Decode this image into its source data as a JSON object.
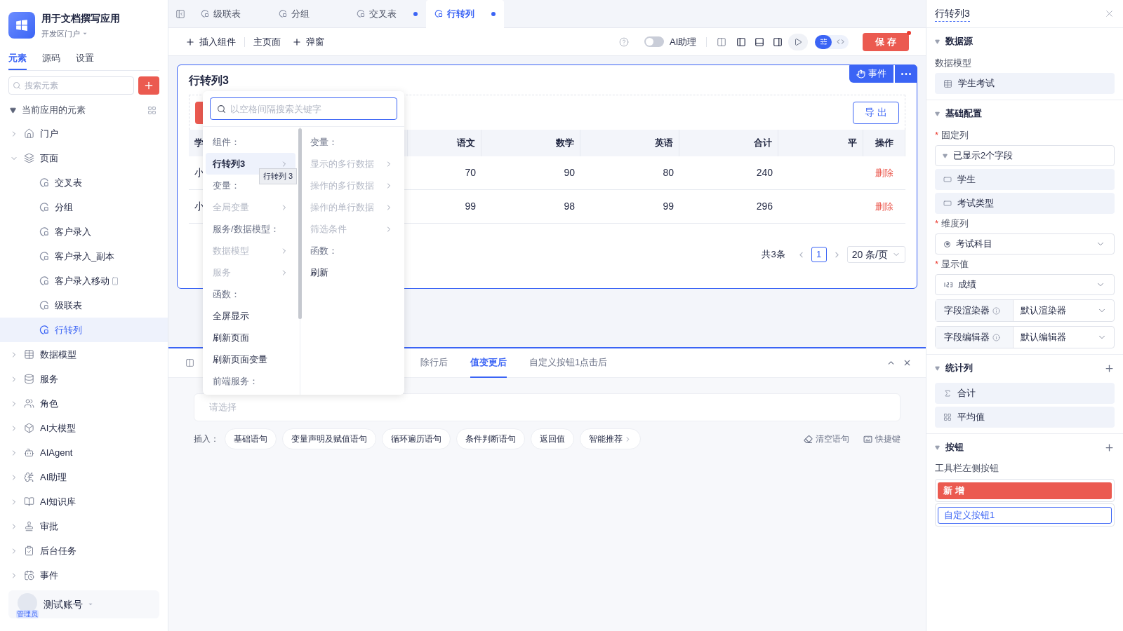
{
  "app": {
    "name": "用于文档撰写应用",
    "portal": "开发区门户"
  },
  "sidebar_tabs": [
    {
      "label": "元素",
      "selected": true
    },
    {
      "label": "源码",
      "selected": false
    },
    {
      "label": "设置",
      "selected": false
    }
  ],
  "element_search": {
    "placeholder": "搜索元素"
  },
  "tree": {
    "label": "当前应用的元素",
    "expanded": true,
    "children": [
      {
        "label": "门户",
        "kind": "home",
        "expanded": false
      },
      {
        "label": "页面",
        "kind": "pages",
        "expanded": true,
        "children": [
          {
            "label": "交叉表",
            "kind": "page",
            "selected": false,
            "mobile": false
          },
          {
            "label": "分组",
            "kind": "page",
            "selected": false,
            "mobile": false
          },
          {
            "label": "客户录入",
            "kind": "page",
            "selected": false,
            "mobile": false
          },
          {
            "label": "客户录入_副本",
            "kind": "page",
            "selected": false,
            "mobile": false
          },
          {
            "label": "客户录入移动",
            "kind": "page",
            "selected": false,
            "mobile": true
          },
          {
            "label": "级联表",
            "kind": "page",
            "selected": false,
            "mobile": false
          },
          {
            "label": "行转列",
            "kind": "page",
            "selected": true,
            "mobile": false
          }
        ]
      },
      {
        "label": "数据模型",
        "kind": "table",
        "expanded": false
      },
      {
        "label": "服务",
        "kind": "service",
        "expanded": false
      },
      {
        "label": "角色",
        "kind": "role",
        "expanded": false
      },
      {
        "label": "AI大模型",
        "kind": "model",
        "expanded": false
      },
      {
        "label": "AIAgent",
        "kind": "agent",
        "expanded": false
      },
      {
        "label": "AI助理",
        "kind": "assistant",
        "expanded": false
      },
      {
        "label": "AI知识库",
        "kind": "knowledge",
        "expanded": false
      },
      {
        "label": "审批",
        "kind": "approval",
        "expanded": false
      },
      {
        "label": "后台任务",
        "kind": "task",
        "expanded": false
      },
      {
        "label": "事件",
        "kind": "event",
        "expanded": false
      }
    ]
  },
  "account": {
    "name": "测试账号",
    "role": "管理员"
  },
  "editor_tabs": [
    {
      "label": "级联表",
      "selected": false,
      "modified": false
    },
    {
      "label": "分组",
      "selected": false,
      "modified": false
    },
    {
      "label": "交叉表",
      "selected": false,
      "modified": true
    },
    {
      "label": "行转列",
      "selected": true,
      "modified": true
    }
  ],
  "toolbar": {
    "insert": "插入组件",
    "home": "主页面",
    "popup": "弹窗",
    "ai_toggle": {
      "label": "AI助理",
      "on": false
    },
    "view_modes": [
      {
        "kind": "settings",
        "selected": true
      },
      {
        "kind": "code",
        "selected": false
      }
    ],
    "save": "保 存",
    "save_badge": true
  },
  "component": {
    "title": "行转列3",
    "event_button": "事件",
    "export_button": "导 出",
    "table": {
      "columns": [
        "学",
        "语文",
        "数学",
        "英语",
        "合计",
        "平",
        "操作"
      ],
      "rows": [
        [
          "小",
          "70",
          "90",
          "80",
          "240",
          "",
          "删除"
        ],
        [
          "小",
          "99",
          "98",
          "99",
          "296",
          "",
          "删除"
        ]
      ]
    },
    "pagination": {
      "total": "共3条",
      "page": "1",
      "page_size": "20 条/页"
    }
  },
  "picker": {
    "search": {
      "placeholder": "以空格间隔搜索关键字"
    },
    "left": [
      {
        "kind": "header",
        "label": "组件："
      },
      {
        "kind": "item",
        "label": "行转列3",
        "disabled": false,
        "selected": true,
        "submenu": true
      },
      {
        "kind": "header",
        "label": "变量："
      },
      {
        "kind": "item",
        "label": "全局变量",
        "disabled": true,
        "selected": false,
        "submenu": true
      },
      {
        "kind": "header",
        "label": "服务/数据模型："
      },
      {
        "kind": "item",
        "label": "数据模型",
        "disabled": true,
        "selected": false,
        "submenu": true
      },
      {
        "kind": "item",
        "label": "服务",
        "disabled": true,
        "selected": false,
        "submenu": true
      },
      {
        "kind": "header",
        "label": "函数："
      },
      {
        "kind": "item",
        "label": "全屏显示",
        "disabled": false,
        "selected": false,
        "submenu": false
      },
      {
        "kind": "item",
        "label": "刷新页面",
        "disabled": false,
        "selected": false,
        "submenu": false
      },
      {
        "kind": "item",
        "label": "刷新页面变量",
        "disabled": false,
        "selected": false,
        "submenu": false
      },
      {
        "kind": "header",
        "label": "前端服务："
      }
    ],
    "right": [
      {
        "kind": "header",
        "label": "变量："
      },
      {
        "kind": "item",
        "label": "显示的多行数据",
        "disabled": true,
        "selected": false,
        "submenu": true
      },
      {
        "kind": "item",
        "label": "操作的多行数据",
        "disabled": true,
        "selected": false,
        "submenu": true
      },
      {
        "kind": "item",
        "label": "操作的单行数据",
        "disabled": true,
        "selected": false,
        "submenu": true
      },
      {
        "kind": "item",
        "label": "筛选条件",
        "disabled": true,
        "selected": false,
        "submenu": true
      },
      {
        "kind": "header",
        "label": "函数："
      },
      {
        "kind": "item",
        "label": "刷新",
        "disabled": false,
        "selected": false,
        "submenu": false
      }
    ],
    "tooltip": "行转列 3"
  },
  "events": {
    "tabs": [
      {
        "label": "除行后",
        "selected": false
      },
      {
        "label": "值变更后",
        "selected": true
      },
      {
        "label": "自定义按钮1点击后",
        "selected": false
      }
    ],
    "action_select": {
      "placeholder": "请选择"
    },
    "insert_label": "插入：",
    "chips": [
      {
        "label": "基础语句",
        "submenu": false
      },
      {
        "label": "变量声明及赋值语句",
        "submenu": false
      },
      {
        "label": "循环遍历语句",
        "submenu": false
      },
      {
        "label": "条件判断语句",
        "submenu": false
      },
      {
        "label": "返回值",
        "submenu": false
      },
      {
        "label": "智能推荐",
        "submenu": true
      }
    ],
    "clear": "清空语句",
    "shortcuts": "快捷键"
  },
  "inspector": {
    "title": "行转列3",
    "required_mark": "*",
    "data_source": {
      "heading": "数据源",
      "model_label": "数据模型",
      "model": "学生考试"
    },
    "basic": {
      "heading": "基础配置",
      "fixed_label": {
        "text": "固定列",
        "required": true
      },
      "fixed_summary": "已显示2个字段",
      "fixed_fields": [
        "学生",
        "考试类型"
      ],
      "dimension_label": {
        "text": "维度列",
        "required": true
      },
      "dimension": "考试科目",
      "value_label": {
        "text": "显示值",
        "required": true
      },
      "value": "成绩",
      "renderer": {
        "label": "字段渲染器",
        "value": "默认渲染器"
      },
      "editor": {
        "label": "字段编辑器",
        "value": "默认编辑器"
      }
    },
    "stats": {
      "heading": "统计列",
      "items": [
        {
          "label": "合计",
          "kind": "sum"
        },
        {
          "label": "平均值",
          "kind": "average"
        }
      ]
    },
    "buttons": {
      "heading": "按钮",
      "toolbar_label": "工具栏左侧按钮",
      "items": [
        {
          "label": "新 增",
          "kind": "danger"
        },
        {
          "label": "自定义按钮1",
          "kind": "outline"
        }
      ]
    }
  }
}
